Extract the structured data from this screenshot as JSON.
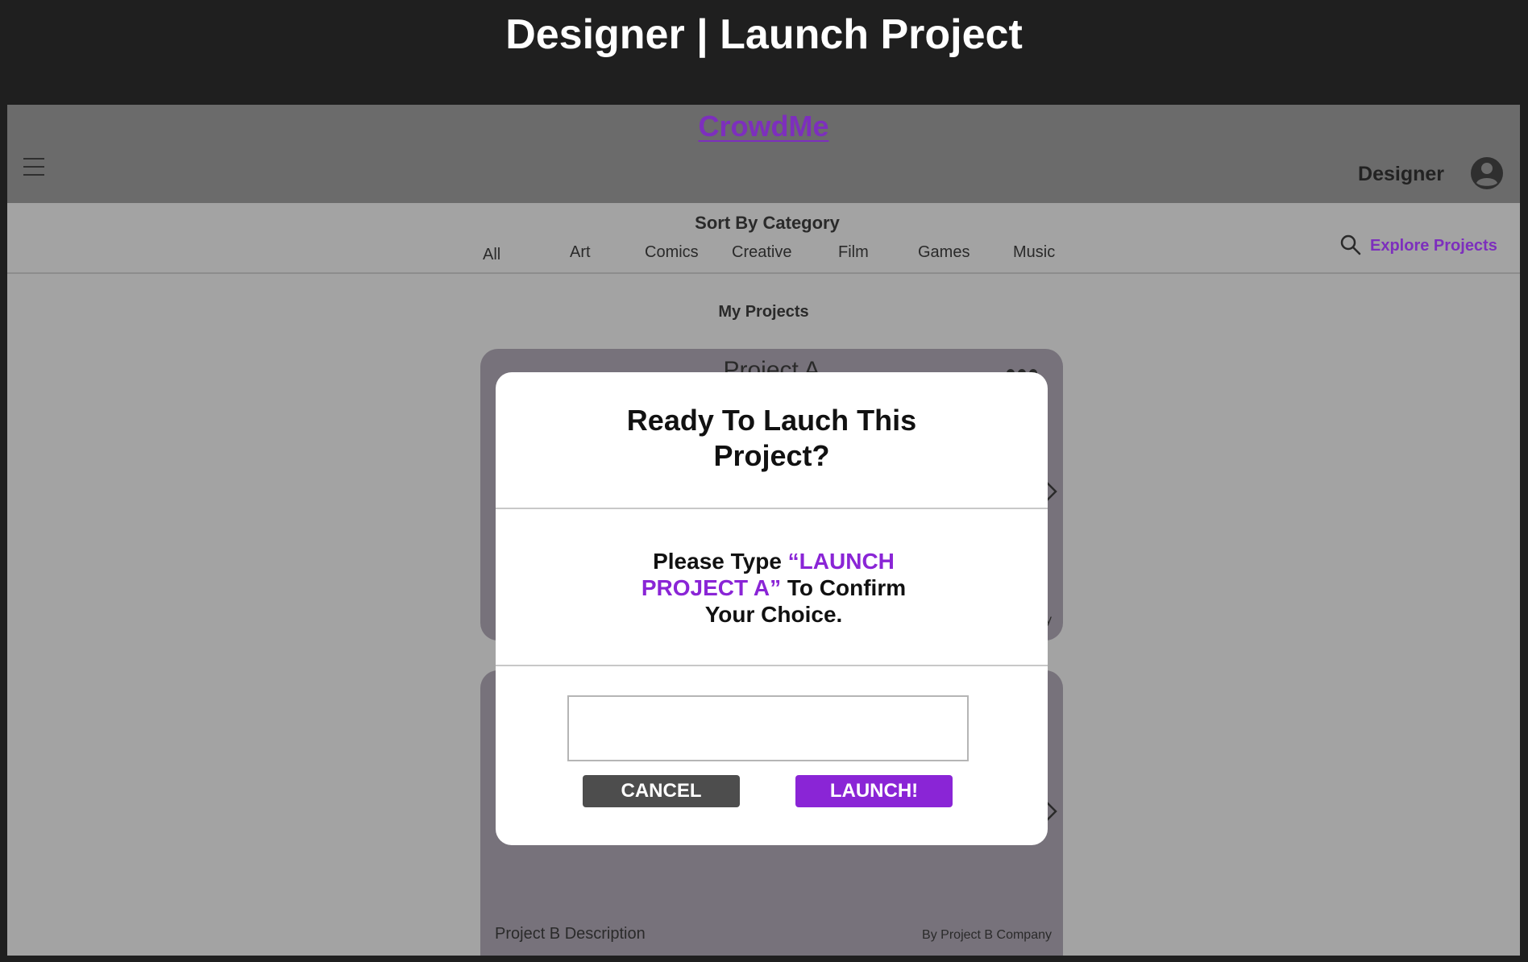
{
  "page": {
    "title": "Designer | Launch Project"
  },
  "header": {
    "brand": "CrowdMe",
    "role": "Designer"
  },
  "categories": {
    "label": "Sort By Category",
    "items": [
      "All",
      "Art",
      "Comics",
      "Creative",
      "Film",
      "Games",
      "Music"
    ]
  },
  "explore": {
    "label": "Explore Projects"
  },
  "main": {
    "section_title": "My Projects",
    "projects": [
      {
        "title": "Project A",
        "company_fragment": "y"
      },
      {
        "description": "Project B Description",
        "company": "By Project B Company"
      }
    ]
  },
  "modal": {
    "title_line1": "Ready To Lauch This",
    "title_line2": "Project?",
    "msg_prefix": "Please Type ",
    "msg_accent": "“LAUNCH PROJECT A”",
    "msg_suffix": " To Confirm Your Choice.",
    "input_value": "",
    "cancel_label": "CANCEL",
    "launch_label": "LAUNCH!"
  },
  "colors": {
    "accent": "#8a25d6",
    "brand": "#7d2fbd",
    "cancel": "#4d4d4d"
  },
  "icons": [
    "hamburger-menu-icon",
    "account-circle-icon",
    "search-icon",
    "more-dots-icon",
    "chevron-right-icon"
  ]
}
